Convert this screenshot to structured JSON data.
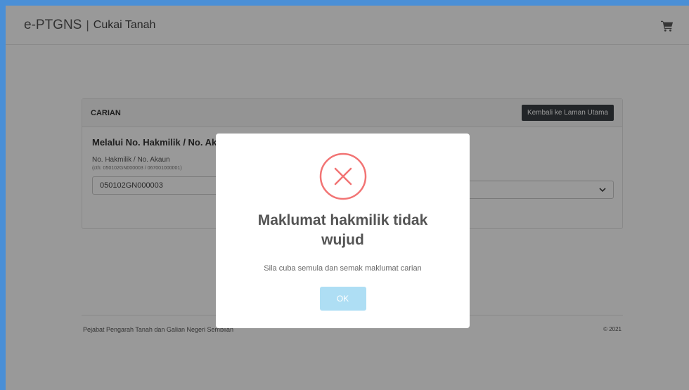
{
  "navbar": {
    "brand": "e-PTGNS",
    "separator": "|",
    "subtitle": "Cukai Tanah",
    "cart_icon": "cart-icon"
  },
  "search_card": {
    "header_title": "CARIAN",
    "back_button_label": "Kembali ke Laman Utama",
    "section_title": "Melalui No. Hakmilik / No. Aka",
    "field_label": "No. Hakmilik / No. Akaun",
    "field_hint": "(cth: 050102GN000003 / 067001000001)",
    "field_value": "050102GN000003"
  },
  "footer": {
    "left_text": "Pejabat Pengarah Tanah dan Galian Negeri Sembilan",
    "right_text": "© 2021"
  },
  "modal": {
    "icon": "error-x-icon",
    "title": "Maklumat hakmilik tidak wujud",
    "message": "Sila cuba semula dan semak maklumat carian",
    "ok_label": "OK"
  },
  "colors": {
    "frame_border": "#4a8fd6",
    "error_red": "#f27474",
    "ok_button": "#aedef4",
    "back_button": "#3a3f44"
  }
}
